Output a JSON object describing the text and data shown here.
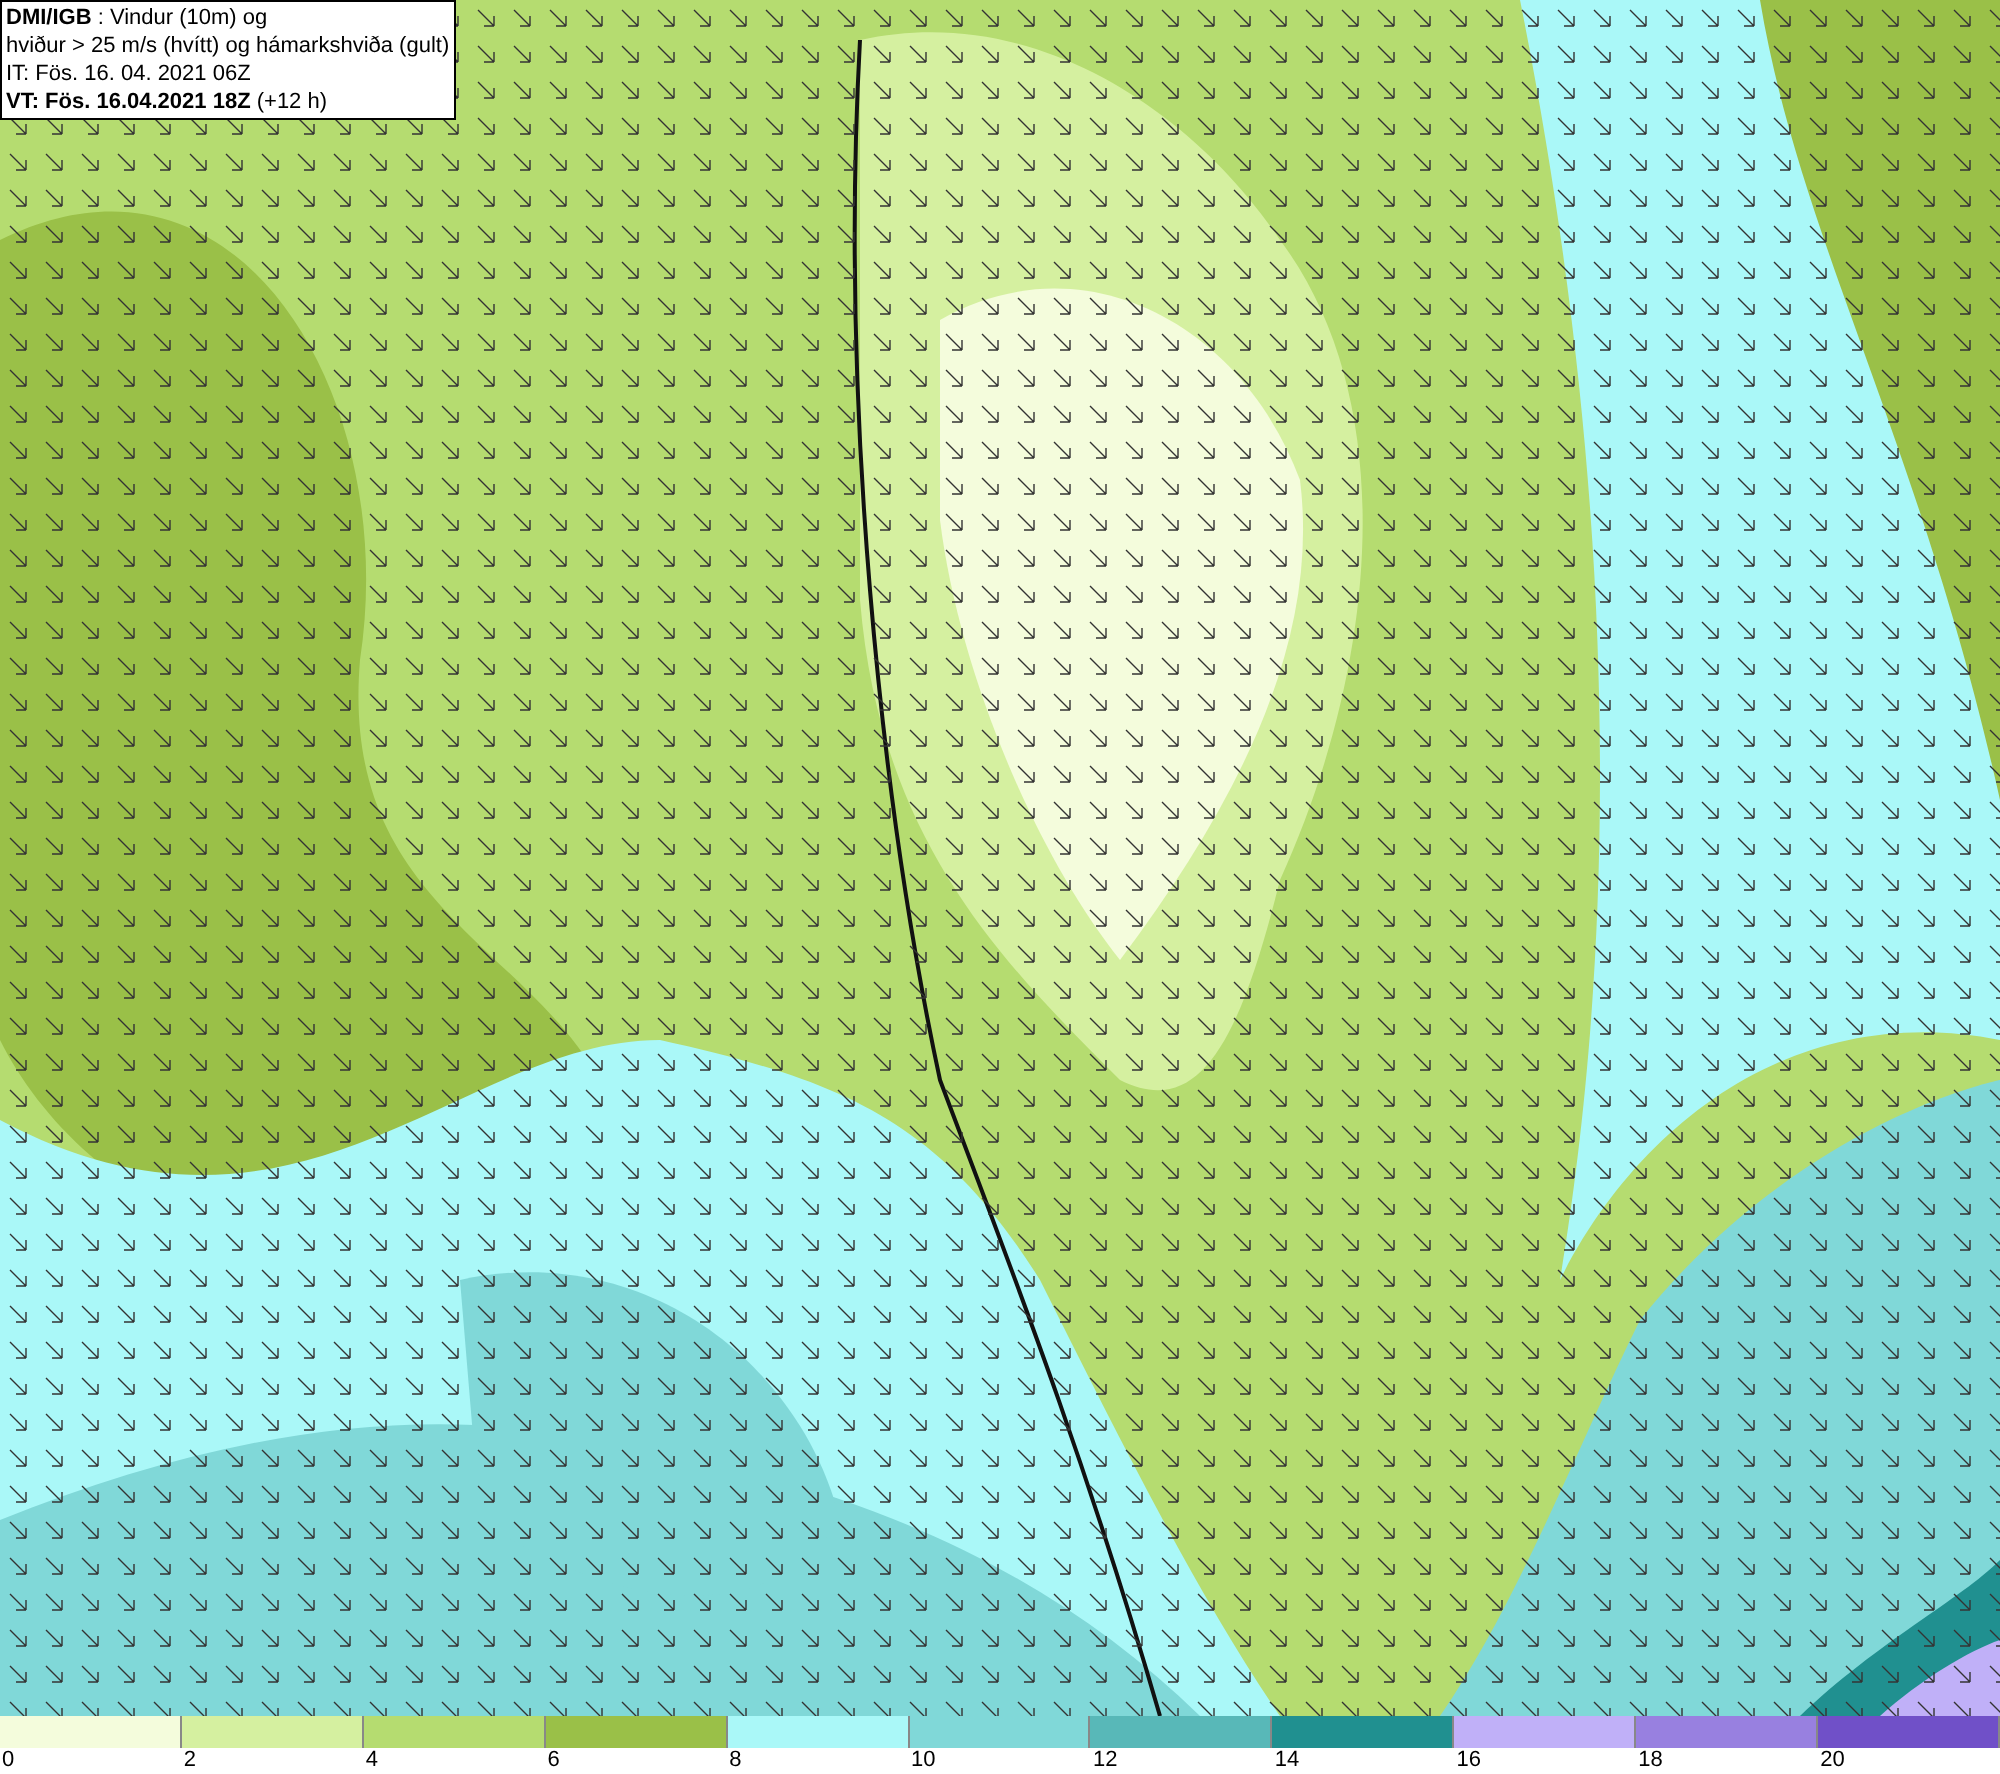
{
  "header": {
    "lines": [
      "**DMI/IGB** : Vindur (10m) og",
      "hviður > 25 m/s (hvítt) og hámarkshviða (gult)",
      "IT: Fös. 16. 04. 2021 06Z",
      "**VT: Fös. 16.04.2021 18Z** (+12 h)"
    ]
  },
  "legend": {
    "bins": [
      {
        "color": "#f4fcdc"
      },
      {
        "color": "#d5f0a0"
      },
      {
        "color": "#b5dc70"
      },
      {
        "color": "#9ac048"
      },
      {
        "color": "#aaf8f8"
      },
      {
        "color": "#80d8d8"
      },
      {
        "color": "#58b8b8"
      },
      {
        "color": "#209090"
      },
      {
        "color": "#c0b0f8"
      },
      {
        "color": "#9880e0"
      },
      {
        "color": "#7050c8"
      }
    ],
    "labels": [
      "0",
      "2",
      "4",
      "6",
      "8",
      "10",
      "12",
      "14",
      "16",
      "18",
      "20"
    ]
  }
}
